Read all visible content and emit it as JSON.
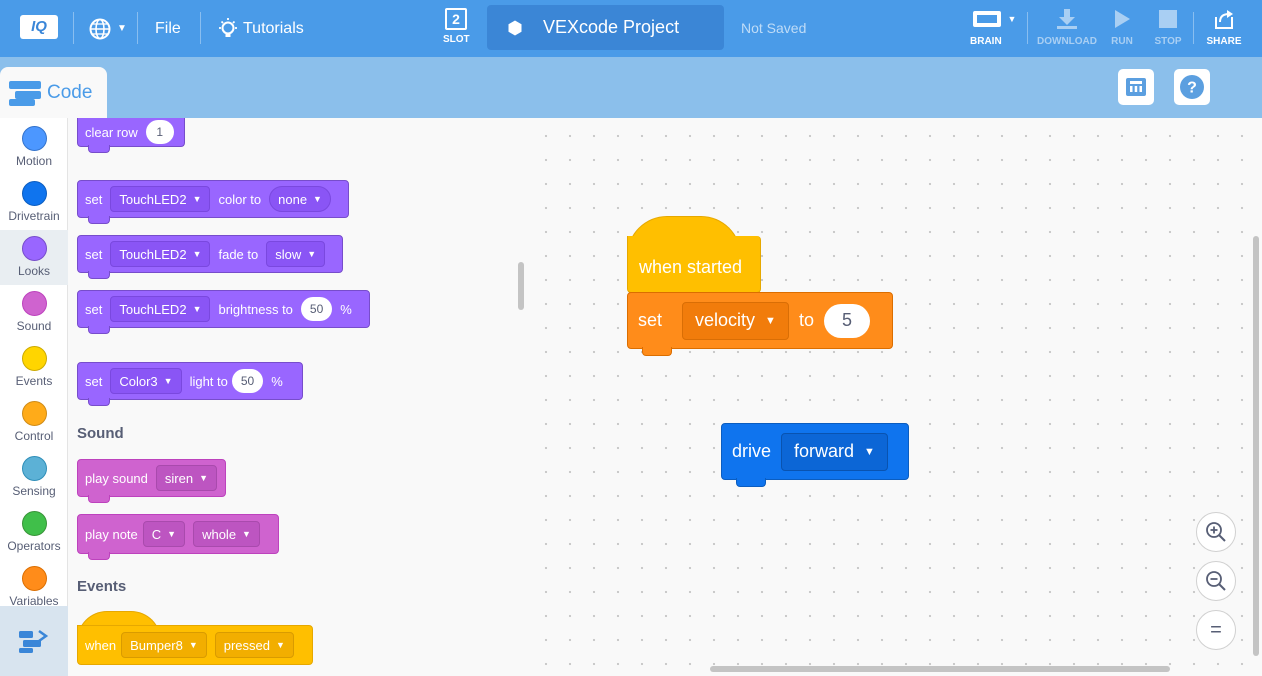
{
  "topbar": {
    "logo": "IQ",
    "file": "File",
    "tutorials": "Tutorials",
    "slot_num": "2",
    "slot_label": "SLOT",
    "project_name": "VEXcode Project",
    "save_status": "Not Saved",
    "brain": "BRAIN",
    "download": "DOWNLOAD",
    "run": "RUN",
    "stop": "STOP",
    "share": "SHARE"
  },
  "code_tab": "Code",
  "categories": [
    {
      "name": "Motion",
      "color": "#4c97ff"
    },
    {
      "name": "Drivetrain",
      "color": "#0f74ee"
    },
    {
      "name": "Looks",
      "color": "#9966ff"
    },
    {
      "name": "Sound",
      "color": "#cf63cf"
    },
    {
      "name": "Events",
      "color": "#ffd500"
    },
    {
      "name": "Control",
      "color": "#ffab19"
    },
    {
      "name": "Sensing",
      "color": "#5cb1d6"
    },
    {
      "name": "Operators",
      "color": "#40bf4a"
    },
    {
      "name": "Variables",
      "color": "#ff8c1a"
    }
  ],
  "palette": {
    "clear_row": {
      "label": "clear row",
      "value": "1"
    },
    "set_color": {
      "set": "set",
      "device": "TouchLED2",
      "label": "color to",
      "value": "none"
    },
    "set_fade": {
      "set": "set",
      "device": "TouchLED2",
      "label": "fade to",
      "value": "slow"
    },
    "set_brightness": {
      "set": "set",
      "device": "TouchLED2",
      "label": "brightness to",
      "value": "50",
      "unit": "%"
    },
    "set_light": {
      "set": "set",
      "device": "Color3",
      "label": "light to",
      "value": "50",
      "unit": "%"
    },
    "sound_header": "Sound",
    "play_sound": {
      "label": "play sound",
      "value": "siren"
    },
    "play_note": {
      "label": "play note",
      "note": "C",
      "duration": "whole"
    },
    "events_header": "Events",
    "when_bumper": {
      "label": "when",
      "device": "Bumper8",
      "state": "pressed"
    }
  },
  "workspace": {
    "when_started": "when started",
    "set_velocity": {
      "set": "set",
      "param": "velocity",
      "to": "to",
      "value": "5"
    },
    "drive": {
      "label": "drive",
      "direction": "forward"
    }
  },
  "zoom": {
    "in": "+",
    "out": "−",
    "reset": "="
  }
}
